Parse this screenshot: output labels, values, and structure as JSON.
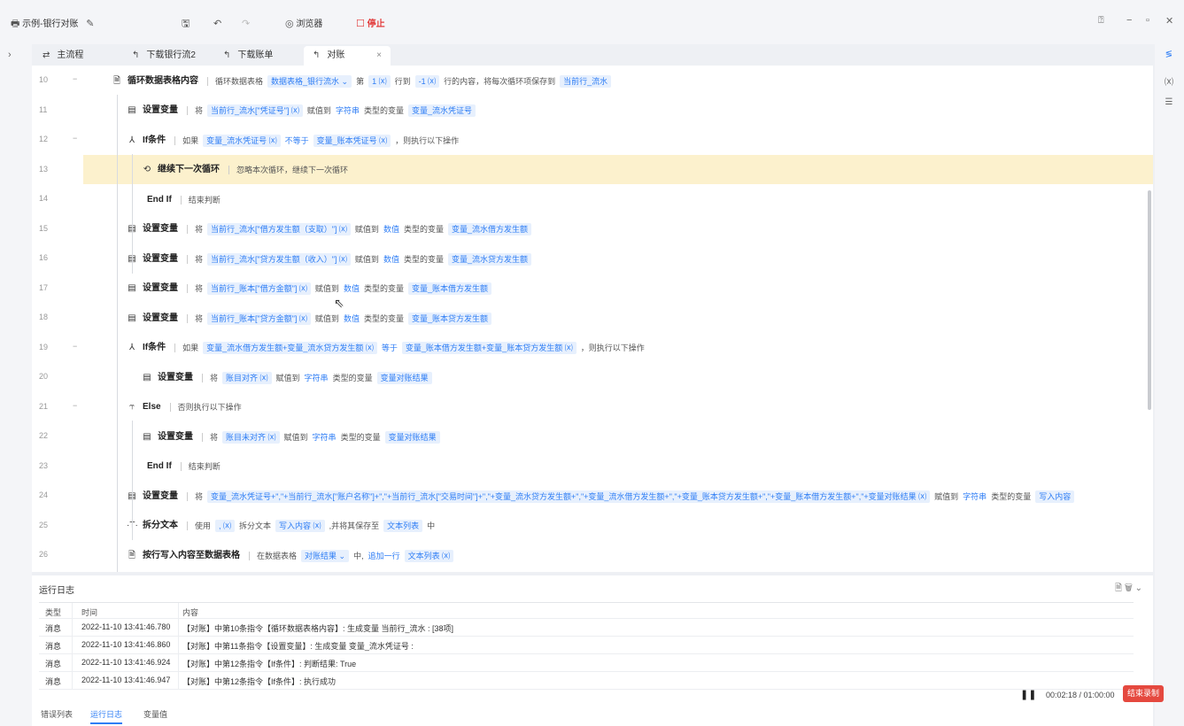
{
  "title": {
    "app_title": "示例-银行对账",
    "save_icon": "save-icon",
    "browser_label": "浏览器",
    "stop_label": "停止"
  },
  "tabs": [
    {
      "label": "主流程"
    },
    {
      "label": "下载银行流2"
    },
    {
      "label": "下载账单"
    },
    {
      "label": "对账"
    }
  ],
  "rows": [
    {
      "no": "10",
      "cmd": "循环数据表格内容",
      "parts": [
        "循环数据表格",
        "[数据表格_银行流水 ⌄]",
        "第",
        "[1 ⒳]",
        "行到",
        "[-1 ⒳]",
        "行的内容，将每次循环项保存到",
        "[当前行_流水]"
      ]
    },
    {
      "no": "11",
      "cmd": "设置变量",
      "parts": [
        "将",
        "[当前行_流水[\"凭证号\"] ⒳]",
        "赋值到",
        "{字符串}",
        "类型的变量",
        "[变量_流水凭证号]"
      ]
    },
    {
      "no": "12",
      "cmd": "If条件",
      "parts": [
        "如果",
        "[变量_流水凭证号 ⒳]",
        "{不等于}",
        "[变量_账本凭证号 ⒳]",
        "，则执行以下操作"
      ]
    },
    {
      "no": "13",
      "cmd": "继续下一次循环",
      "parts": [
        "忽略本次循环，继续下一次循环"
      ]
    },
    {
      "no": "14",
      "cmd": "End If",
      "parts": [
        "结束判断"
      ]
    },
    {
      "no": "15",
      "cmd": "设置变量",
      "parts": [
        "将",
        "[当前行_流水[\"借方发生额（支取）\"] ⒳]",
        "赋值到",
        "{数值}",
        "类型的变量",
        "[变量_流水借方发生额]"
      ]
    },
    {
      "no": "16",
      "cmd": "设置变量",
      "parts": [
        "将",
        "[当前行_流水[\"贷方发生额（收入）\"] ⒳]",
        "赋值到",
        "{数值}",
        "类型的变量",
        "[变量_流水贷方发生额]"
      ]
    },
    {
      "no": "17",
      "cmd": "设置变量",
      "parts": [
        "将",
        "[当前行_账本[\"借方金额\"] ⒳]",
        "赋值到",
        "{数值}",
        "类型的变量",
        "[变量_账本借方发生额]"
      ]
    },
    {
      "no": "18",
      "cmd": "设置变量",
      "parts": [
        "将",
        "[当前行_账本[\"贷方金额\"] ⒳]",
        "赋值到",
        "{数值}",
        "类型的变量",
        "[变量_账本贷方发生额]"
      ]
    },
    {
      "no": "19",
      "cmd": "If条件",
      "parts": [
        "如果",
        "[变量_流水借方发生额+变量_流水贷方发生额 ⒳]",
        "{等于}",
        "[变量_账本借方发生额+变量_账本贷方发生额 ⒳]",
        "，则执行以下操作"
      ]
    },
    {
      "no": "20",
      "cmd": "设置变量",
      "parts": [
        "将",
        "[账目对齐 ⒳]",
        "赋值到",
        "{字符串}",
        "类型的变量",
        "[变量对账结果]"
      ]
    },
    {
      "no": "21",
      "cmd": "Else",
      "parts": [
        "否则执行以下操作"
      ]
    },
    {
      "no": "22",
      "cmd": "设置变量",
      "parts": [
        "将",
        "[账目未对齐 ⒳]",
        "赋值到",
        "{字符串}",
        "类型的变量",
        "[变量对账结果]"
      ]
    },
    {
      "no": "23",
      "cmd": "End If",
      "parts": [
        "结束判断"
      ]
    },
    {
      "no": "24",
      "cmd": "设置变量",
      "parts": [
        "将",
        "[变量_流水凭证号+\",\"+当前行_流水[\"账户名称\"]+\",\"+当前行_流水[\"交易时间\"]+\",\"+变量_流水贷方发生额+\",\"+变量_流水借方发生额+\",\"+变量_账本贷方发生额+\",\"+变量_账本借方发生额+\",\"+变量对账结果 ⒳]",
        "赋值到",
        "{字符串}",
        "类型的变量",
        "[写入内容]"
      ]
    },
    {
      "no": "25",
      "cmd": "拆分文本",
      "parts": [
        "使用",
        "[, ⒳]",
        "拆分文本",
        "[写入内容 ⒳]",
        ",并将其保存至",
        "[文本列表]",
        "中"
      ]
    },
    {
      "no": "26",
      "cmd": "按行写入内容至数据表格",
      "parts": [
        "在数据表格",
        "[对账结果 ⌄]",
        "中,",
        "{追加一行}",
        "[文本列表 ⒳]"
      ]
    }
  ],
  "log": {
    "title": "运行日志",
    "headers": [
      "类型",
      "时间",
      "内容"
    ],
    "entries": [
      {
        "type": "消息",
        "time": "2022-11-10 13:41:46.780",
        "content": "【对账】中第10条指令【循环数据表格内容】: 生成变量 当前行_流水 : [38项]"
      },
      {
        "type": "消息",
        "time": "2022-11-10 13:41:46.860",
        "content": "【对账】中第11条指令【设置变量】: 生成变量 变量_流水凭证号 :"
      },
      {
        "type": "消息",
        "time": "2022-11-10 13:41:46.924",
        "content": "【对账】中第12条指令【If条件】: 判断结果: True"
      },
      {
        "type": "消息",
        "time": "2022-11-10 13:41:46.947",
        "content": "【对账】中第12条指令【If条件】: 执行成功"
      }
    ],
    "tabs": [
      "错误列表",
      "运行日志",
      "变量值"
    ]
  },
  "recording": {
    "time": "00:02:18 / 01:00:00",
    "end_label": "结束录制"
  }
}
